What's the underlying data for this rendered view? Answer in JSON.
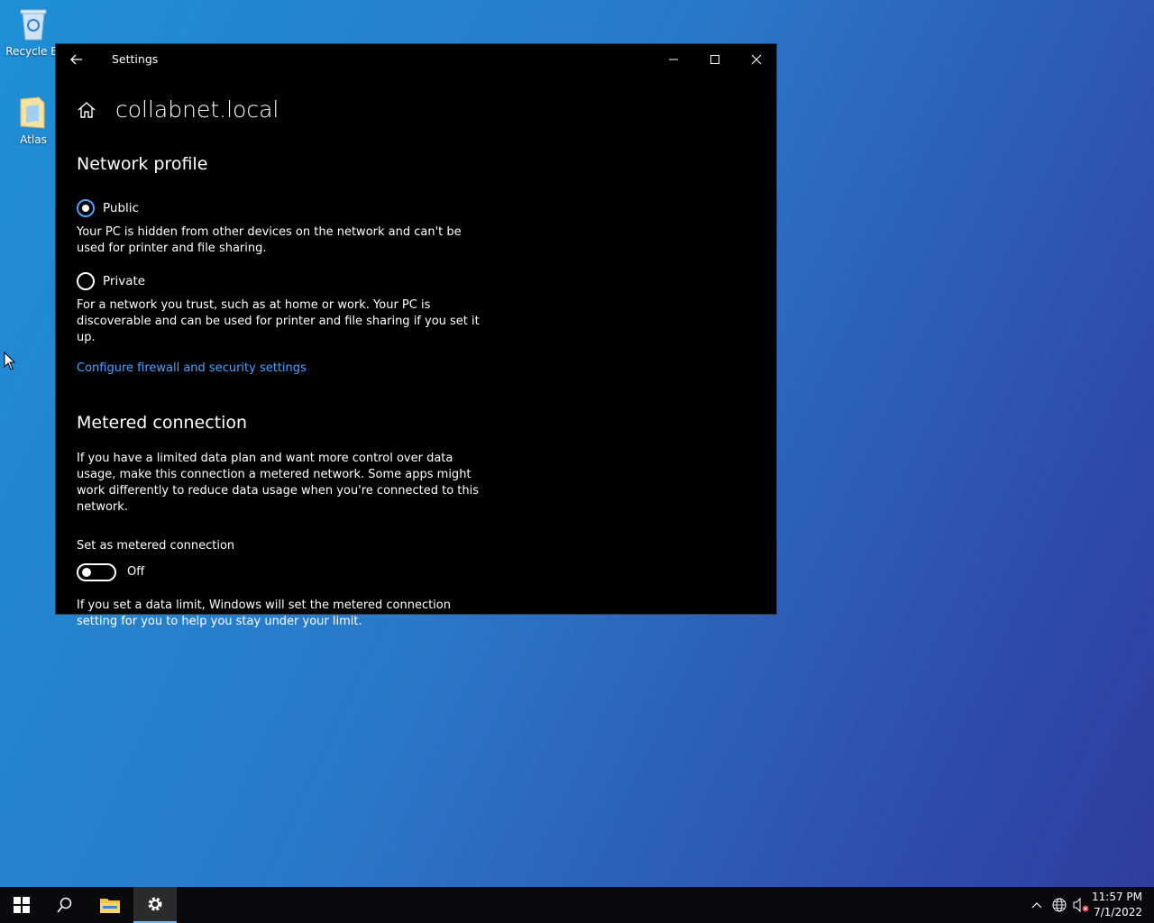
{
  "desktop": {
    "icons": [
      {
        "label": "Recycle Bi"
      },
      {
        "label": "Atlas"
      }
    ]
  },
  "window": {
    "title": "Settings",
    "page_title": "collabnet.local"
  },
  "network_profile": {
    "heading": "Network profile",
    "options": [
      {
        "label": "Public",
        "selected": true,
        "description": "Your PC is hidden from other devices on the network and can't be used for printer and file sharing."
      },
      {
        "label": "Private",
        "selected": false,
        "description": "For a network you trust, such as at home or work. Your PC is discoverable and can be used for printer and file sharing if you set it up."
      }
    ],
    "link": "Configure firewall and security settings"
  },
  "metered": {
    "heading": "Metered connection",
    "description": "If you have a limited data plan and want more control over data usage, make this connection a metered network. Some apps might work differently to reduce data usage when you're connected to this network.",
    "toggle_label": "Set as metered connection",
    "toggle_state": "Off",
    "footer": "If you set a data limit, Windows will set the metered connection setting for you to help you stay under your limit."
  },
  "taskbar": {
    "time": "11:57 PM",
    "date": "7/1/2022"
  },
  "colors": {
    "accent": "#4aa3ff",
    "window_bg": "#000000",
    "taskbar_bg": "#0a0a0c"
  }
}
